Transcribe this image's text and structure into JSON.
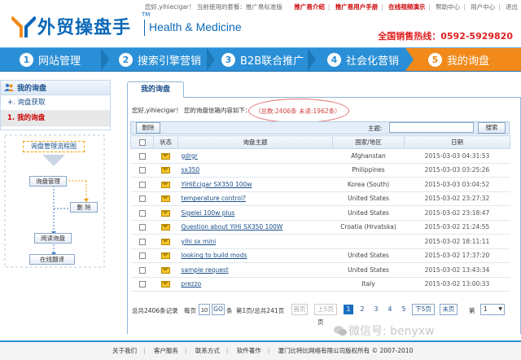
{
  "topbar": {
    "greeting": "您好,yihiecigar！ 当前使用的套餐：推广易标准版",
    "links": [
      {
        "label": "推广易介绍",
        "red": true
      },
      {
        "label": "推广易用户手册",
        "red": true
      },
      {
        "label": "在线视频演示",
        "red": true
      },
      {
        "label": "帮助中心",
        "red": false
      },
      {
        "label": "用户中心",
        "red": false
      },
      {
        "label": "退出",
        "red": false
      }
    ]
  },
  "logo": {
    "cn": "外贸操盘手",
    "tm": "TM",
    "en": "Health & Medicine"
  },
  "hotline": "全国销售热线：0592-5929820",
  "steps": [
    {
      "num": "1",
      "label": "网站管理"
    },
    {
      "num": "2",
      "label": "搜索引擎营销"
    },
    {
      "num": "3",
      "label": "B2B联合推广"
    },
    {
      "num": "4",
      "label": "社会化营销"
    },
    {
      "num": "5",
      "label": "我的询盘"
    }
  ],
  "sidebar": {
    "title": "我的询盘",
    "items": [
      {
        "label": "+. 询盘获取"
      },
      {
        "label": "1. 我的询盘"
      }
    ]
  },
  "flow": {
    "title": "询盘管理流程图",
    "manage": "询盘管理",
    "delete": "删 除",
    "read": "阅读询盘",
    "translate": "在线翻译"
  },
  "main": {
    "tab": "我的询盘",
    "info": "您好,yihiecigar！ 您的询盘信箱内容如下：",
    "stats": "（总数:2406条   未读:1962条）",
    "delete_btn": "删除",
    "subject_label": "主题:",
    "subject_value": "",
    "search_btn": "搜索"
  },
  "table": {
    "headers": [
      "",
      "状态",
      "询盘主题",
      "国家/地区",
      "日期"
    ],
    "rows": [
      {
        "subject": "gdrgr",
        "country": "Afghanstan",
        "date": "2015-03-03 04:31:53"
      },
      {
        "subject": "sx350",
        "country": "Philippines",
        "date": "2015-03-03 03:25:26"
      },
      {
        "subject": "YiHiEcigar SX350 100w",
        "country": "Korea (South)",
        "date": "2015-03-03 03:04:52"
      },
      {
        "subject": "temperature control?",
        "country": "United States",
        "date": "2015-03-02 23:27:32"
      },
      {
        "subject": "Sigelei 100w plus",
        "country": "United States",
        "date": "2015-03-02 23:18:47"
      },
      {
        "subject": "Question about YiHi SX350 100W",
        "country": "Croatia (Hrvatska)",
        "date": "2015-03-02 21:24:55"
      },
      {
        "subject": "yihi sx mini",
        "country": "",
        "date": "2015-03-02 18:11:11"
      },
      {
        "subject": "looking to build mods",
        "country": "United States",
        "date": "2015-03-02 17:37:20"
      },
      {
        "subject": "sample request",
        "country": "United States",
        "date": "2015-03-02 13:43:34"
      },
      {
        "subject": "prezzo",
        "country": "Italy",
        "date": "2015-03-02 13:00:33"
      }
    ]
  },
  "pager": {
    "total": "总共2406条记录",
    "per_page_pre": "每页",
    "per_page": "10",
    "go": "GO",
    "per_page_post": "条",
    "page_info": "第1页/总共241页",
    "first": "首页",
    "prev": "上5页",
    "pages": [
      "1",
      "2",
      "3",
      "4",
      "5"
    ],
    "next": "下5页",
    "last": "末页",
    "page_pre": "第",
    "page_select": "1",
    "page_post": "页"
  },
  "footer": {
    "links": [
      "关于我们",
      "客户服务",
      "联系方式",
      "软件著作"
    ],
    "copyright": "厦门比特比网络有限公司版权所有 © 2007-2010"
  },
  "watermark": "微信号: benyxw",
  "colors": {
    "brand": "#0b68b8",
    "nav": "#2a8fd6",
    "active": "#f18a1b",
    "hotline": "#e02020"
  }
}
